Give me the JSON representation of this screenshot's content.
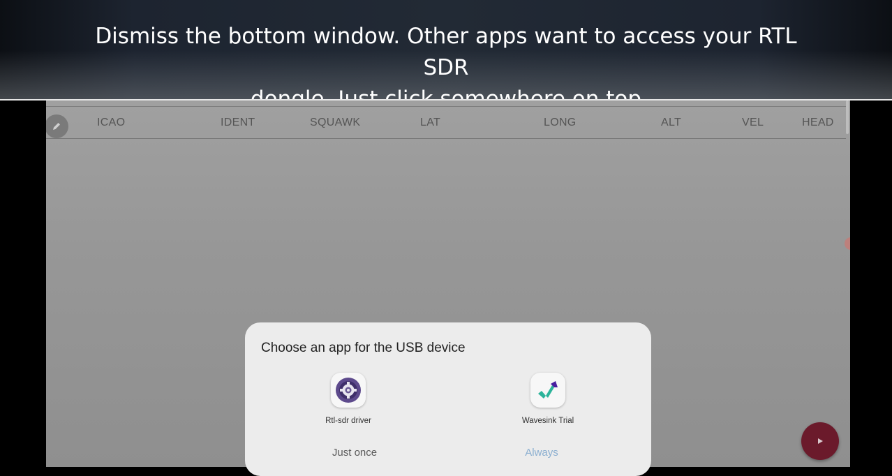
{
  "caption": {
    "line1": "Dismiss the bottom window. Other apps want to access your RTL SDR",
    "line2": "dongle. Just click somewhere on top"
  },
  "table": {
    "columns": [
      "ICAO",
      "IDENT",
      "SQUAWK",
      "LAT",
      "LONG",
      "ALT",
      "VEL",
      "HEAD"
    ]
  },
  "icons": {
    "edit": "pencil-icon",
    "play": "play-icon",
    "rtl_sdr": "gear-icon",
    "wavesink": "wavesink-logo-icon"
  },
  "dialog": {
    "title": "Choose an app for the USB device",
    "apps": [
      {
        "label": "Rtl-sdr driver"
      },
      {
        "label": "Wavesink Trial"
      }
    ],
    "buttons": {
      "once": "Just once",
      "always": "Always"
    }
  },
  "colors": {
    "accent": "#6b1a2b",
    "always_button": "#8aaed0",
    "wavesink_teal": "#2bb39a",
    "wavesink_purple": "#4a1fa0"
  }
}
